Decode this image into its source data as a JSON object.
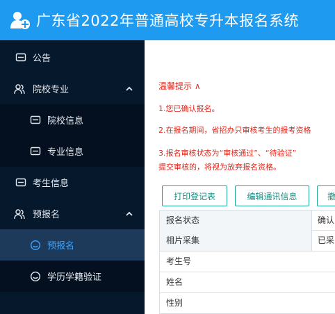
{
  "app": {
    "title": "广东省2022年普通高校专升本报名系统",
    "logo_icon": "user-plus-icon",
    "header_color": "#1e9af0"
  },
  "sidebar": {
    "items": [
      {
        "label": "公告",
        "icon": "monitor-icon"
      },
      {
        "label": "院校专业",
        "icon": "users-icon",
        "expanded": true
      },
      {
        "label": "院校信息",
        "icon": "monitor-icon"
      },
      {
        "label": "专业信息",
        "icon": "monitor-icon"
      },
      {
        "label": "考生信息",
        "icon": "monitor-icon"
      },
      {
        "label": "预报名",
        "icon": "users-icon",
        "expanded": true
      },
      {
        "label": "预报名",
        "icon": "smile-icon",
        "active": true
      },
      {
        "label": "学历学籍验证",
        "icon": "smile-icon"
      }
    ]
  },
  "notice": {
    "title": "温馨提示 ∧",
    "line1": "1.您已确认报名。",
    "line2": "2.在报名期间，省招办只审核考生的报考资格",
    "line3a": "3.报名审核状态为“审核通过”、“待验证”",
    "line3b": "提交审核的，将视为放弃报名资格。"
  },
  "buttons": {
    "print": "打印登记表",
    "edit_contact": "编辑通讯信息",
    "third": "撤"
  },
  "info_table": [
    {
      "key": "报名状态",
      "value": "确认"
    },
    {
      "key": "相片采集",
      "value": "已采"
    },
    {
      "key": "考生号",
      "value": ""
    },
    {
      "key": "姓名",
      "value": ""
    },
    {
      "key": "性别",
      "value": ""
    }
  ],
  "colors": {
    "sidebar_bg": "#06182c",
    "active_text": "#3ea4ff",
    "notice_red": "#e0261b",
    "button_teal": "#1fa89a"
  }
}
